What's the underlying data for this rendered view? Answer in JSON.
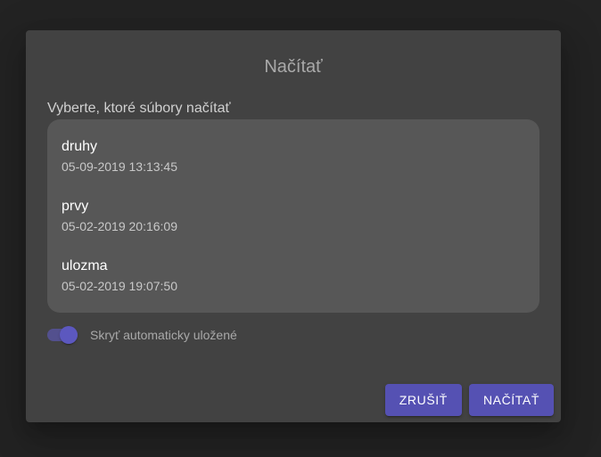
{
  "dialog": {
    "title": "Načítať",
    "subtitle": "Vyberte, ktoré súbory načítať",
    "files": [
      {
        "name": "druhy",
        "date": "05-09-2019 13:13:45"
      },
      {
        "name": "prvy",
        "date": "05-02-2019 20:16:09"
      },
      {
        "name": "ulozma",
        "date": "05-02-2019 19:07:50"
      }
    ],
    "toggle": {
      "label": "Skryť automaticky uložené",
      "checked": true
    },
    "actions": {
      "cancel_label": "ZRUŠIŤ",
      "load_label": "NAČÍTAŤ"
    }
  },
  "colors": {
    "accent": "#5551b3",
    "dialog_bg": "#424242",
    "list_bg": "#575757",
    "backdrop": "#232323"
  }
}
